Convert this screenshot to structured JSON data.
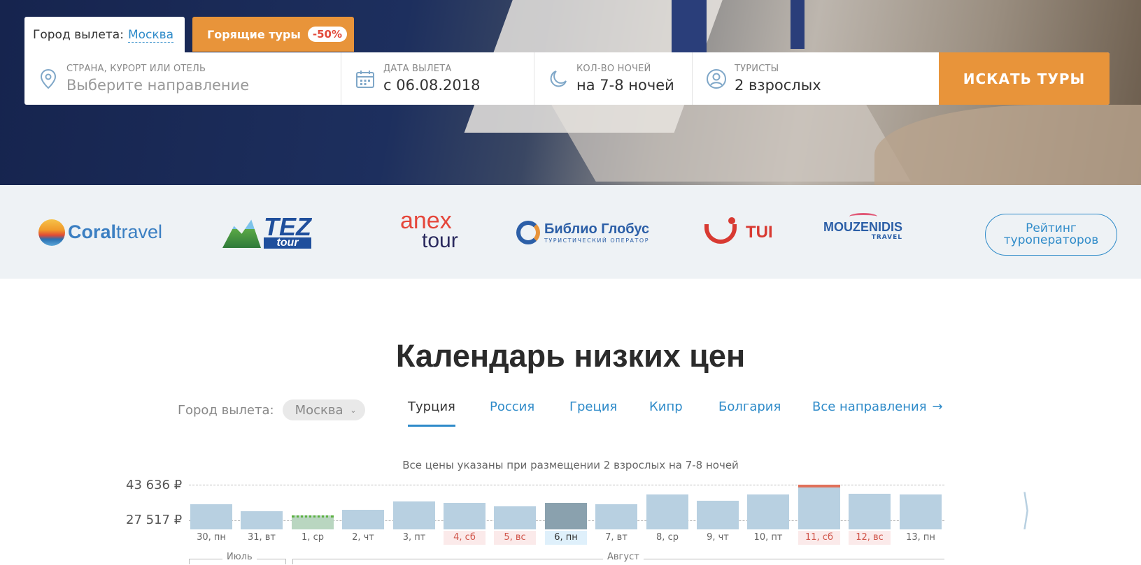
{
  "search": {
    "city_label": "Город вылета:",
    "city_value": "Москва",
    "hot_label": "Горящие туры",
    "hot_badge": "-50%",
    "dest_label": "Страна, курорт или отель",
    "dest_placeholder": "Выберите направление",
    "date_label": "Дата вылета",
    "date_value": "с 06.08.2018",
    "nights_label": "Кол-во ночей",
    "nights_value": "на 7-8 ночей",
    "tourists_label": "Туристы",
    "tourists_value": "2 взрослых",
    "search_button": "ИСКАТЬ ТУРЫ",
    "icons": [
      "location-pin-icon",
      "calendar-icon",
      "moon-icon",
      "user-icon"
    ]
  },
  "operators": {
    "coral_a": "Coral",
    "coral_b": "travel",
    "tez": "TEZ",
    "tez_sub": "tour",
    "anex_top": "anex",
    "anex_bot": "tour",
    "biblio_name": "Библио Глобус",
    "biblio_sub": "ТУРИСТИЧЕСКИЙ ОПЕРАТОР",
    "tui": "TUI",
    "mouz_name": "MOUZENIDIS",
    "mouz_sub": "TRAVEL",
    "rating_button_line1": "Рейтинг",
    "rating_button_line2": "туроператоров"
  },
  "calendar": {
    "title": "Календарь низких цен",
    "city_label": "Город вылета:",
    "city_value": "Москва",
    "tabs": [
      "Турция",
      "Россия",
      "Греция",
      "Кипр",
      "Болгария",
      "Все направления"
    ],
    "active_tab": 0,
    "note": "Все цены указаны при размещении 2 взрослых на 7-8 ночей",
    "y_max_label": "43 636 ₽",
    "y_min_label": "27 517 ₽",
    "months": [
      "Июль",
      "Август"
    ]
  },
  "chart_data": {
    "type": "bar",
    "categories": [
      "30, пн",
      "31, вт",
      "1, ср",
      "2, чт",
      "3, пт",
      "4, сб",
      "5, вс",
      "6, пн",
      "7, вт",
      "8, ср",
      "9, чт",
      "10, пт",
      "11, сб",
      "12, вс",
      "13, пн"
    ],
    "values": [
      33200,
      29700,
      27517,
      30300,
      34900,
      33900,
      32200,
      34000,
      33300,
      38600,
      35200,
      38400,
      43636,
      38800,
      38400
    ],
    "weekend": [
      false,
      false,
      false,
      false,
      false,
      true,
      true,
      false,
      false,
      false,
      false,
      false,
      true,
      true,
      false
    ],
    "selected_index": 7,
    "min_index": 2,
    "max_index": 12,
    "ylim": [
      20000,
      43636
    ],
    "y_ticks": [
      "43 636 ₽",
      "27 517 ₽"
    ],
    "colors": {
      "bar": "#b8d0e1",
      "selected": "#8aa1ae",
      "max_cap": "#e0705a",
      "min_cap": "#5bb040"
    }
  }
}
